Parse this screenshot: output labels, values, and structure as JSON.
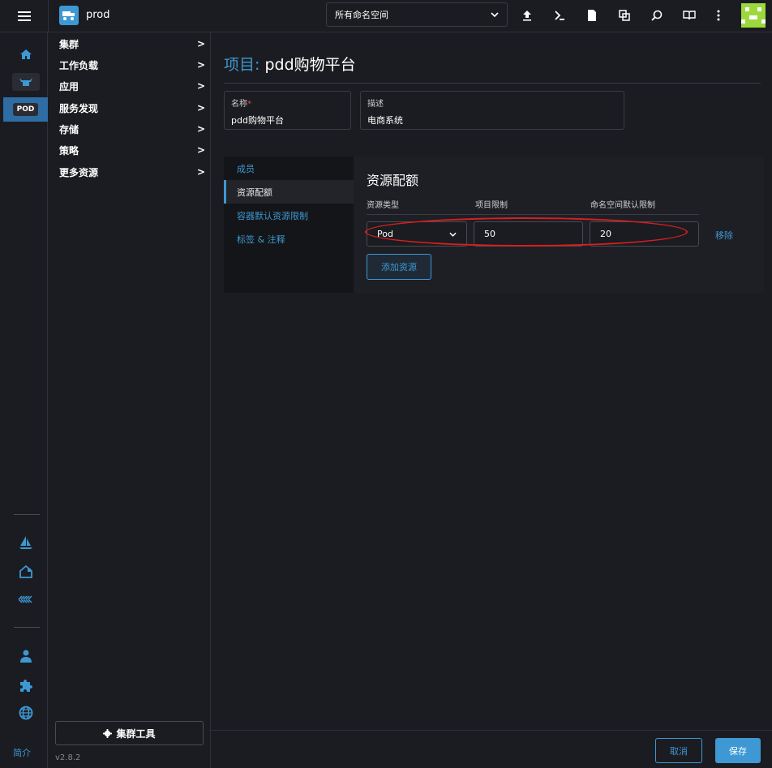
{
  "header": {
    "cluster_name": "prod",
    "namespace_select": "所有命名空间",
    "icons": [
      "upload-icon",
      "terminal-icon",
      "file-icon",
      "copy-icon",
      "search-icon",
      "book-icon",
      "more-vert-icon"
    ]
  },
  "rail": {
    "pod_badge": "POD",
    "about": "简介"
  },
  "sidenav": {
    "items": [
      {
        "label": "集群"
      },
      {
        "label": "工作负载"
      },
      {
        "label": "应用"
      },
      {
        "label": "服务发现"
      },
      {
        "label": "存储"
      },
      {
        "label": "策略"
      },
      {
        "label": "更多资源"
      }
    ],
    "chevron": ">",
    "tools_label": "集群工具",
    "version": "v2.8.2"
  },
  "main": {
    "title_prefix": "项目:",
    "title_name": "pdd购物平台",
    "name_label": "名称",
    "required_mark": "*",
    "name_value": "pdd购物平台",
    "desc_label": "描述",
    "desc_value": "电商系统",
    "tabs": [
      {
        "label": "成员"
      },
      {
        "label": "资源配额"
      },
      {
        "label": "容器默认资源限制"
      },
      {
        "label": "标签 & 注释"
      }
    ],
    "quota": {
      "title": "资源配额",
      "col_type": "资源类型",
      "col_project": "项目限制",
      "col_ns": "命名空间默认限制",
      "type_value": "Pod",
      "project_value": "50",
      "ns_value": "20",
      "remove_label": "移除",
      "add_label": "添加资源"
    }
  },
  "footer": {
    "cancel": "取消",
    "save": "保存"
  },
  "colors": {
    "accent": "#3d98d3",
    "highlight": "#d42020",
    "avatar": "#9bd93c"
  }
}
